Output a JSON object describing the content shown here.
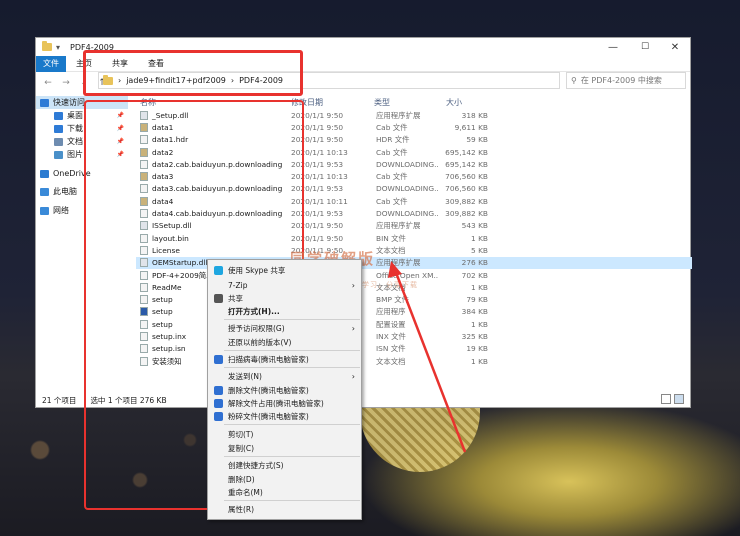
{
  "window": {
    "title": "PDF4-2009",
    "minimize": "—",
    "maximize": "☐",
    "close": "✕"
  },
  "ribbon": {
    "tabs": [
      "文件",
      "主页",
      "共享",
      "查看"
    ]
  },
  "address": {
    "path_segments": [
      "jade9+findit17+pdf2009",
      "PDF4-2009"
    ],
    "search_placeholder": "在 PDF4-2009 中搜索"
  },
  "columns": {
    "name": "名称",
    "date": "修改日期",
    "type": "类型",
    "size": "大小"
  },
  "nav": [
    {
      "label": "快速访问",
      "icon": "star-icon",
      "color": "#2e7bd6",
      "selected": true
    },
    {
      "label": "桌面",
      "icon": "desktop-icon",
      "color": "#2e7bd6",
      "pinned": true
    },
    {
      "label": "下载",
      "icon": "download-icon",
      "color": "#2e7bd6",
      "pinned": true
    },
    {
      "label": "文档",
      "icon": "document-icon",
      "color": "#6e8cb0",
      "pinned": true
    },
    {
      "label": "图片",
      "icon": "picture-icon",
      "color": "#4a90c9",
      "pinned": true
    },
    {
      "label": "OneDrive",
      "icon": "cloud-icon",
      "color": "#2b7bd1"
    },
    {
      "label": "此电脑",
      "icon": "computer-icon",
      "color": "#3a8ad8"
    },
    {
      "label": "网络",
      "icon": "network-icon",
      "color": "#3a8ad8"
    }
  ],
  "files": [
    {
      "name": "_Setup.dll",
      "date": "2020/1/1 9:50",
      "type": "应用程序扩展",
      "size": "318 KB"
    },
    {
      "name": "data1",
      "date": "2020/1/1 9:50",
      "type": "Cab 文件",
      "size": "9,611 KB"
    },
    {
      "name": "data1.hdr",
      "date": "2020/1/1 9:50",
      "type": "HDR 文件",
      "size": "59 KB"
    },
    {
      "name": "data2",
      "date": "2020/1/1 10:13",
      "type": "Cab 文件",
      "size": "695,142 KB"
    },
    {
      "name": "data2.cab.baiduyun.p.downloading",
      "date": "2020/1/1 9:53",
      "type": "DOWNLOADING...",
      "size": "695,142 KB"
    },
    {
      "name": "data3",
      "date": "2020/1/1 10:13",
      "type": "Cab 文件",
      "size": "706,560 KB"
    },
    {
      "name": "data3.cab.baiduyun.p.downloading",
      "date": "2020/1/1 9:53",
      "type": "DOWNLOADING...",
      "size": "706,560 KB"
    },
    {
      "name": "data4",
      "date": "2020/1/1 10:11",
      "type": "Cab 文件",
      "size": "309,882 KB"
    },
    {
      "name": "data4.cab.baiduyun.p.downloading",
      "date": "2020/1/1 9:53",
      "type": "DOWNLOADING...",
      "size": "309,882 KB"
    },
    {
      "name": "ISSetup.dll",
      "date": "2020/1/1 9:50",
      "type": "应用程序扩展",
      "size": "543 KB"
    },
    {
      "name": "layout.bin",
      "date": "2020/1/1 9:50",
      "type": "BIN 文件",
      "size": "1 KB"
    },
    {
      "name": "License",
      "date": "2020/1/1 9:50",
      "type": "文本文档",
      "size": "5 KB"
    },
    {
      "name": "OEMStartup.dll",
      "date": "2020/1/1 9:50",
      "type": "应用程序扩展",
      "size": "276 KB",
      "selected": true
    },
    {
      "name": "PDF-4+2009简单安装",
      "date": "",
      "type": "Office Open XM...",
      "size": "702 KB"
    },
    {
      "name": "ReadMe",
      "date": "",
      "type": "文本文档",
      "size": "1 KB"
    },
    {
      "name": "setup",
      "date": "",
      "type": "BMP 文件",
      "size": "79 KB"
    },
    {
      "name": "setup",
      "date": "",
      "type": "应用程序",
      "size": "384 KB"
    },
    {
      "name": "setup",
      "date": "",
      "type": "配置设置",
      "size": "1 KB"
    },
    {
      "name": "setup.inx",
      "date": "",
      "type": "INX 文件",
      "size": "325 KB"
    },
    {
      "name": "setup.isn",
      "date": "",
      "type": "ISN 文件",
      "size": "19 KB"
    },
    {
      "name": "安装须知",
      "date": "",
      "type": "文本文档",
      "size": "1 KB"
    }
  ],
  "status": {
    "count": "21 个项目",
    "selection": "选中 1 个项目  276 KB"
  },
  "context_menu": [
    {
      "label": "使用 Skype 共享",
      "icon": "skype-icon",
      "color": "#1ea6e0"
    },
    {
      "label": "7-Zip",
      "arrow": true
    },
    {
      "label": "共享",
      "icon": "share-icon",
      "color": "#555555"
    },
    {
      "label": "打开方式(H)...",
      "bold": true
    },
    {
      "label": "授予访问权限(G)",
      "arrow": true
    },
    {
      "label": "还原以前的版本(V)"
    },
    {
      "label": "扫描病毒(腾讯电脑管家)",
      "icon": "shield-icon",
      "color": "#2f6fd1"
    },
    {
      "label": "发送到(N)",
      "arrow": true
    },
    {
      "label": "删除文件(腾讯电脑管家)",
      "icon": "delete-icon",
      "color": "#2f6fd1"
    },
    {
      "label": "解除文件占用(腾讯电脑管家)",
      "icon": "unlock-icon",
      "color": "#2f6fd1"
    },
    {
      "label": "粉碎文件(腾讯电脑管家)",
      "icon": "shred-icon",
      "color": "#2f6fd1"
    },
    {
      "label": "剪切(T)"
    },
    {
      "label": "复制(C)"
    },
    {
      "label": "创建快捷方式(S)"
    },
    {
      "label": "删除(D)"
    },
    {
      "label": "重命名(M)"
    },
    {
      "label": "属性(R)"
    }
  ],
  "watermark": {
    "title": "同学破解版",
    "subtitle": "软件、资源、破解、学习，分享下载"
  },
  "colors": {
    "accent": "#1979ca",
    "annotation": "#e8322e",
    "selection": "#cce8ff"
  }
}
